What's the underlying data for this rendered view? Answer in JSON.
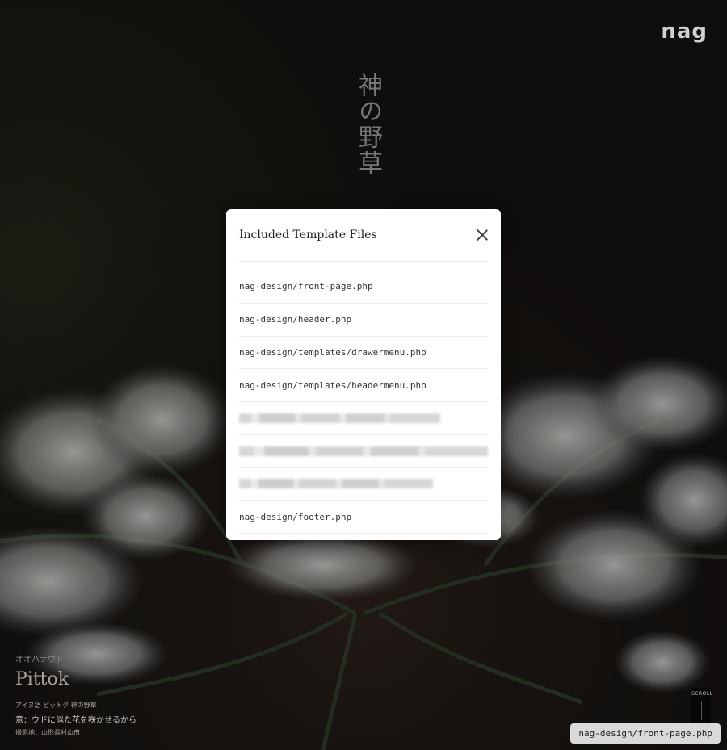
{
  "site": {
    "logo": "nag",
    "vertical_title": "神の野草"
  },
  "plant": {
    "kana": "オオハナウド",
    "name": "Pittok",
    "meta": "アイヌ語 ピットク 神の野草",
    "meaning": "意：ウドに似た花を咲かせるから",
    "location": "撮影地：山形県村山市"
  },
  "scroll_indicator": {
    "label": "SCROLL"
  },
  "current_file_chip": "nag-design/front-page.php",
  "modal": {
    "title": "Included Template Files",
    "files": [
      {
        "label": "nag-design/front-page.php",
        "blurred": false
      },
      {
        "label": "nag-design/header.php",
        "blurred": false
      },
      {
        "label": "nag-design/templates/drawermenu.php",
        "blurred": false
      },
      {
        "label": "nag-design/templates/headermenu.php",
        "blurred": false
      },
      {
        "label": "",
        "blurred": true,
        "redacted_width_frac": 0.81
      },
      {
        "label": "",
        "blurred": true,
        "redacted_width_frac": 1.0
      },
      {
        "label": "",
        "blurred": true,
        "redacted_width_frac": 0.78
      },
      {
        "label": "nag-design/footer.php",
        "blurred": false
      }
    ]
  }
}
